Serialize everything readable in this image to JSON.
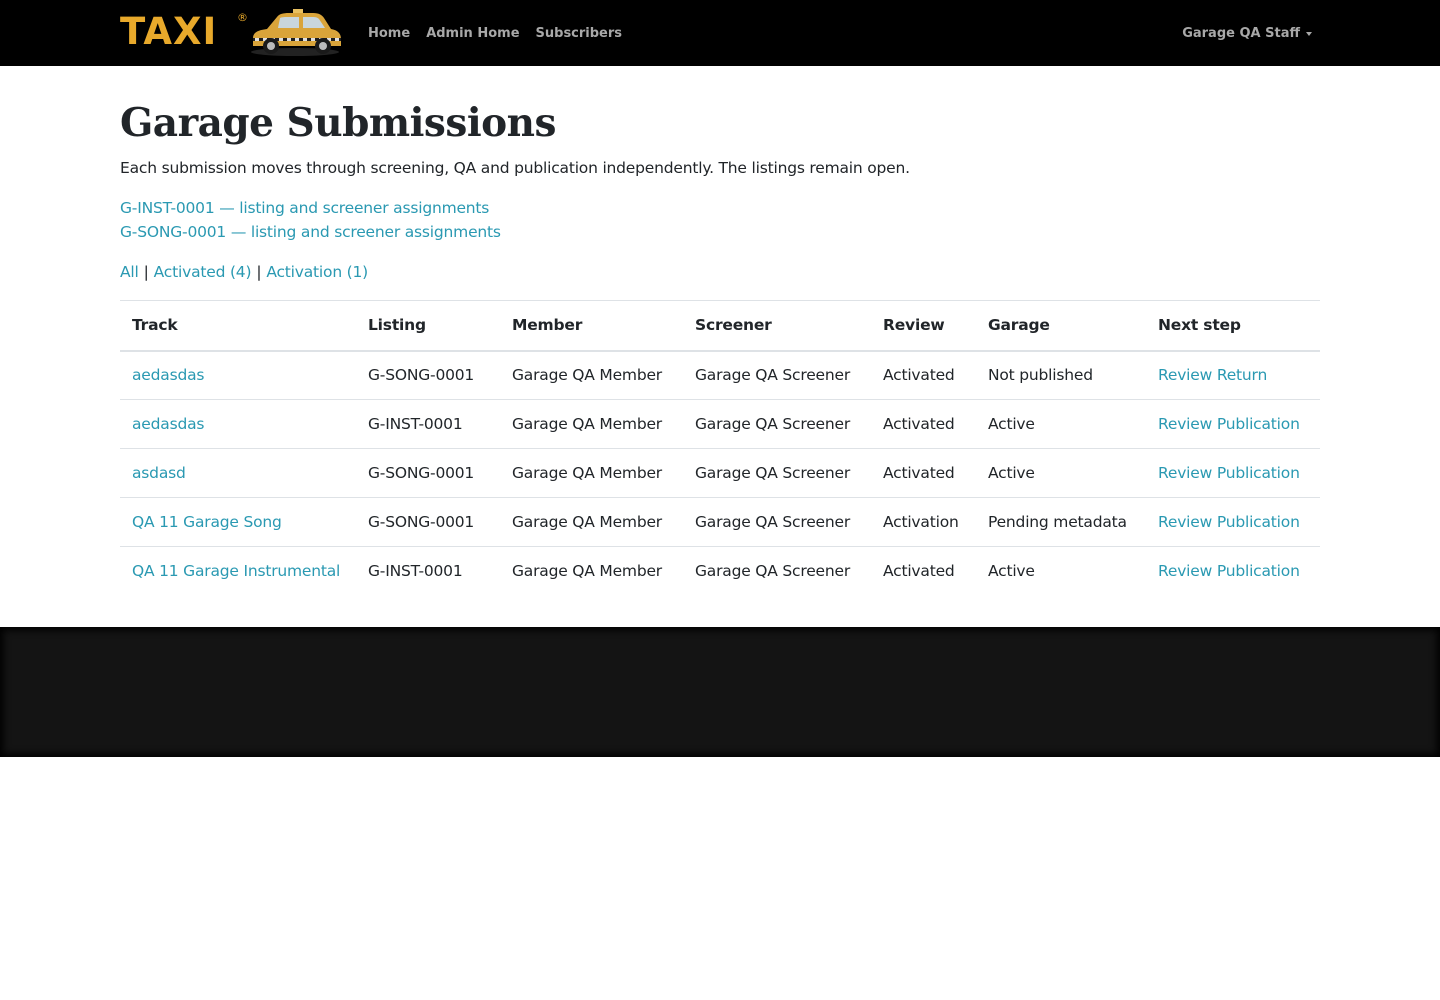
{
  "navbar": {
    "logo_text": "TAXI",
    "logo_mark": "®",
    "logo_image": "taxi-cab-icon",
    "links": [
      "Home",
      "Admin Home",
      "Subscribers"
    ],
    "user_menu": "Garage QA Staff"
  },
  "page": {
    "title": "Garage Submissions",
    "intro": "Each submission moves through screening, QA and publication independently. The listings remain open.",
    "listing_links": [
      "G-INST-0001 — listing and screener assignments",
      "G-SONG-0001 — listing and screener assignments"
    ],
    "filters": {
      "all": "All",
      "activated": "Activated (4)",
      "activation": "Activation (1)",
      "separator": "|"
    }
  },
  "table": {
    "headers": [
      "Track",
      "Listing",
      "Member",
      "Screener",
      "Review",
      "Garage",
      "Next step"
    ],
    "rows": [
      {
        "track": "aedasdas",
        "listing": "G-SONG-0001",
        "member": "Garage QA Member",
        "screener": "Garage QA Screener",
        "review": "Activated",
        "garage": "Not published",
        "next": "Review Return"
      },
      {
        "track": "aedasdas",
        "listing": "G-INST-0001",
        "member": "Garage QA Member",
        "screener": "Garage QA Screener",
        "review": "Activated",
        "garage": "Active",
        "next": "Review Publication"
      },
      {
        "track": "asdasd",
        "listing": "G-SONG-0001",
        "member": "Garage QA Member",
        "screener": "Garage QA Screener",
        "review": "Activated",
        "garage": "Active",
        "next": "Review Publication"
      },
      {
        "track": "QA 11 Garage Song",
        "listing": "G-SONG-0001",
        "member": "Garage QA Member",
        "screener": "Garage QA Screener",
        "review": "Activation",
        "garage": "Pending metadata",
        "next": "Review Publication"
      },
      {
        "track": "QA 11 Garage Instrumental",
        "listing": "G-INST-0001",
        "member": "Garage QA Member",
        "screener": "Garage QA Screener",
        "review": "Activated",
        "garage": "Active",
        "next": "Review Publication"
      }
    ]
  },
  "colors": {
    "navbar_bg": "#000000",
    "logo": "#e8a92b",
    "link": "#2a99b2",
    "nav_text": "#a8a8a8",
    "footer_bg": "#141414"
  }
}
